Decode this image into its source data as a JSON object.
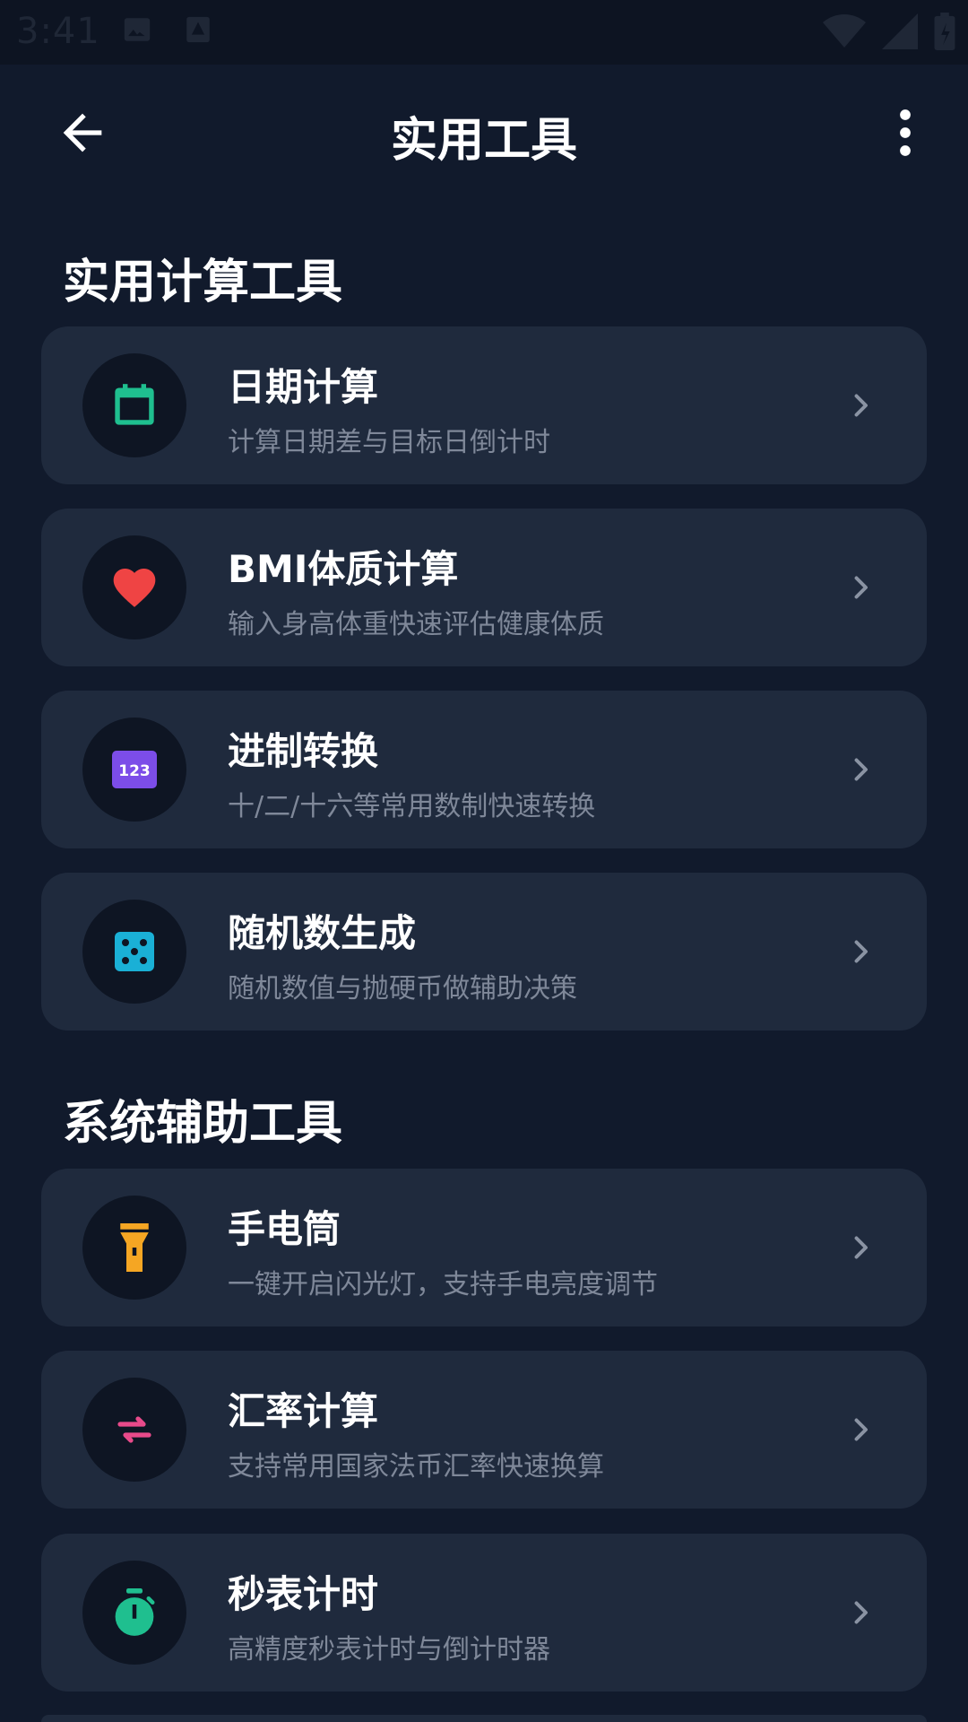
{
  "status_bar": {
    "time": "3:41"
  },
  "app_bar": {
    "title": "实用工具"
  },
  "sections": [
    {
      "title": "实用计算工具",
      "items": [
        {
          "title": "日期计算",
          "subtitle": "计算日期差与目标日倒计时",
          "icon": "calendar-icon",
          "color": "#1fbf8f"
        },
        {
          "title": "BMI体质计算",
          "subtitle": "输入身高体重快速评估健康体质",
          "icon": "heart-icon",
          "color": "#ef4444"
        },
        {
          "title": "进制转换",
          "subtitle": "十/二/十六等常用数制快速转换",
          "icon": "number-123-icon",
          "color": "#7c4de8",
          "icon_text": "123"
        },
        {
          "title": "随机数生成",
          "subtitle": "随机数值与抛硬币做辅助决策",
          "icon": "dice-icon",
          "color": "#1ab0d6"
        }
      ]
    },
    {
      "title": "系统辅助工具",
      "items": [
        {
          "title": "手电筒",
          "subtitle": "一键开启闪光灯，支持手电亮度调节",
          "icon": "flashlight-icon",
          "color": "#f5a623"
        },
        {
          "title": "汇率计算",
          "subtitle": "支持常用国家法币汇率快速换算",
          "icon": "swap-arrows-icon",
          "color": "#e84a8a"
        },
        {
          "title": "秒表计时",
          "subtitle": "高精度秒表计时与倒计时器",
          "icon": "stopwatch-icon",
          "color": "#1fbf8f"
        }
      ]
    }
  ]
}
